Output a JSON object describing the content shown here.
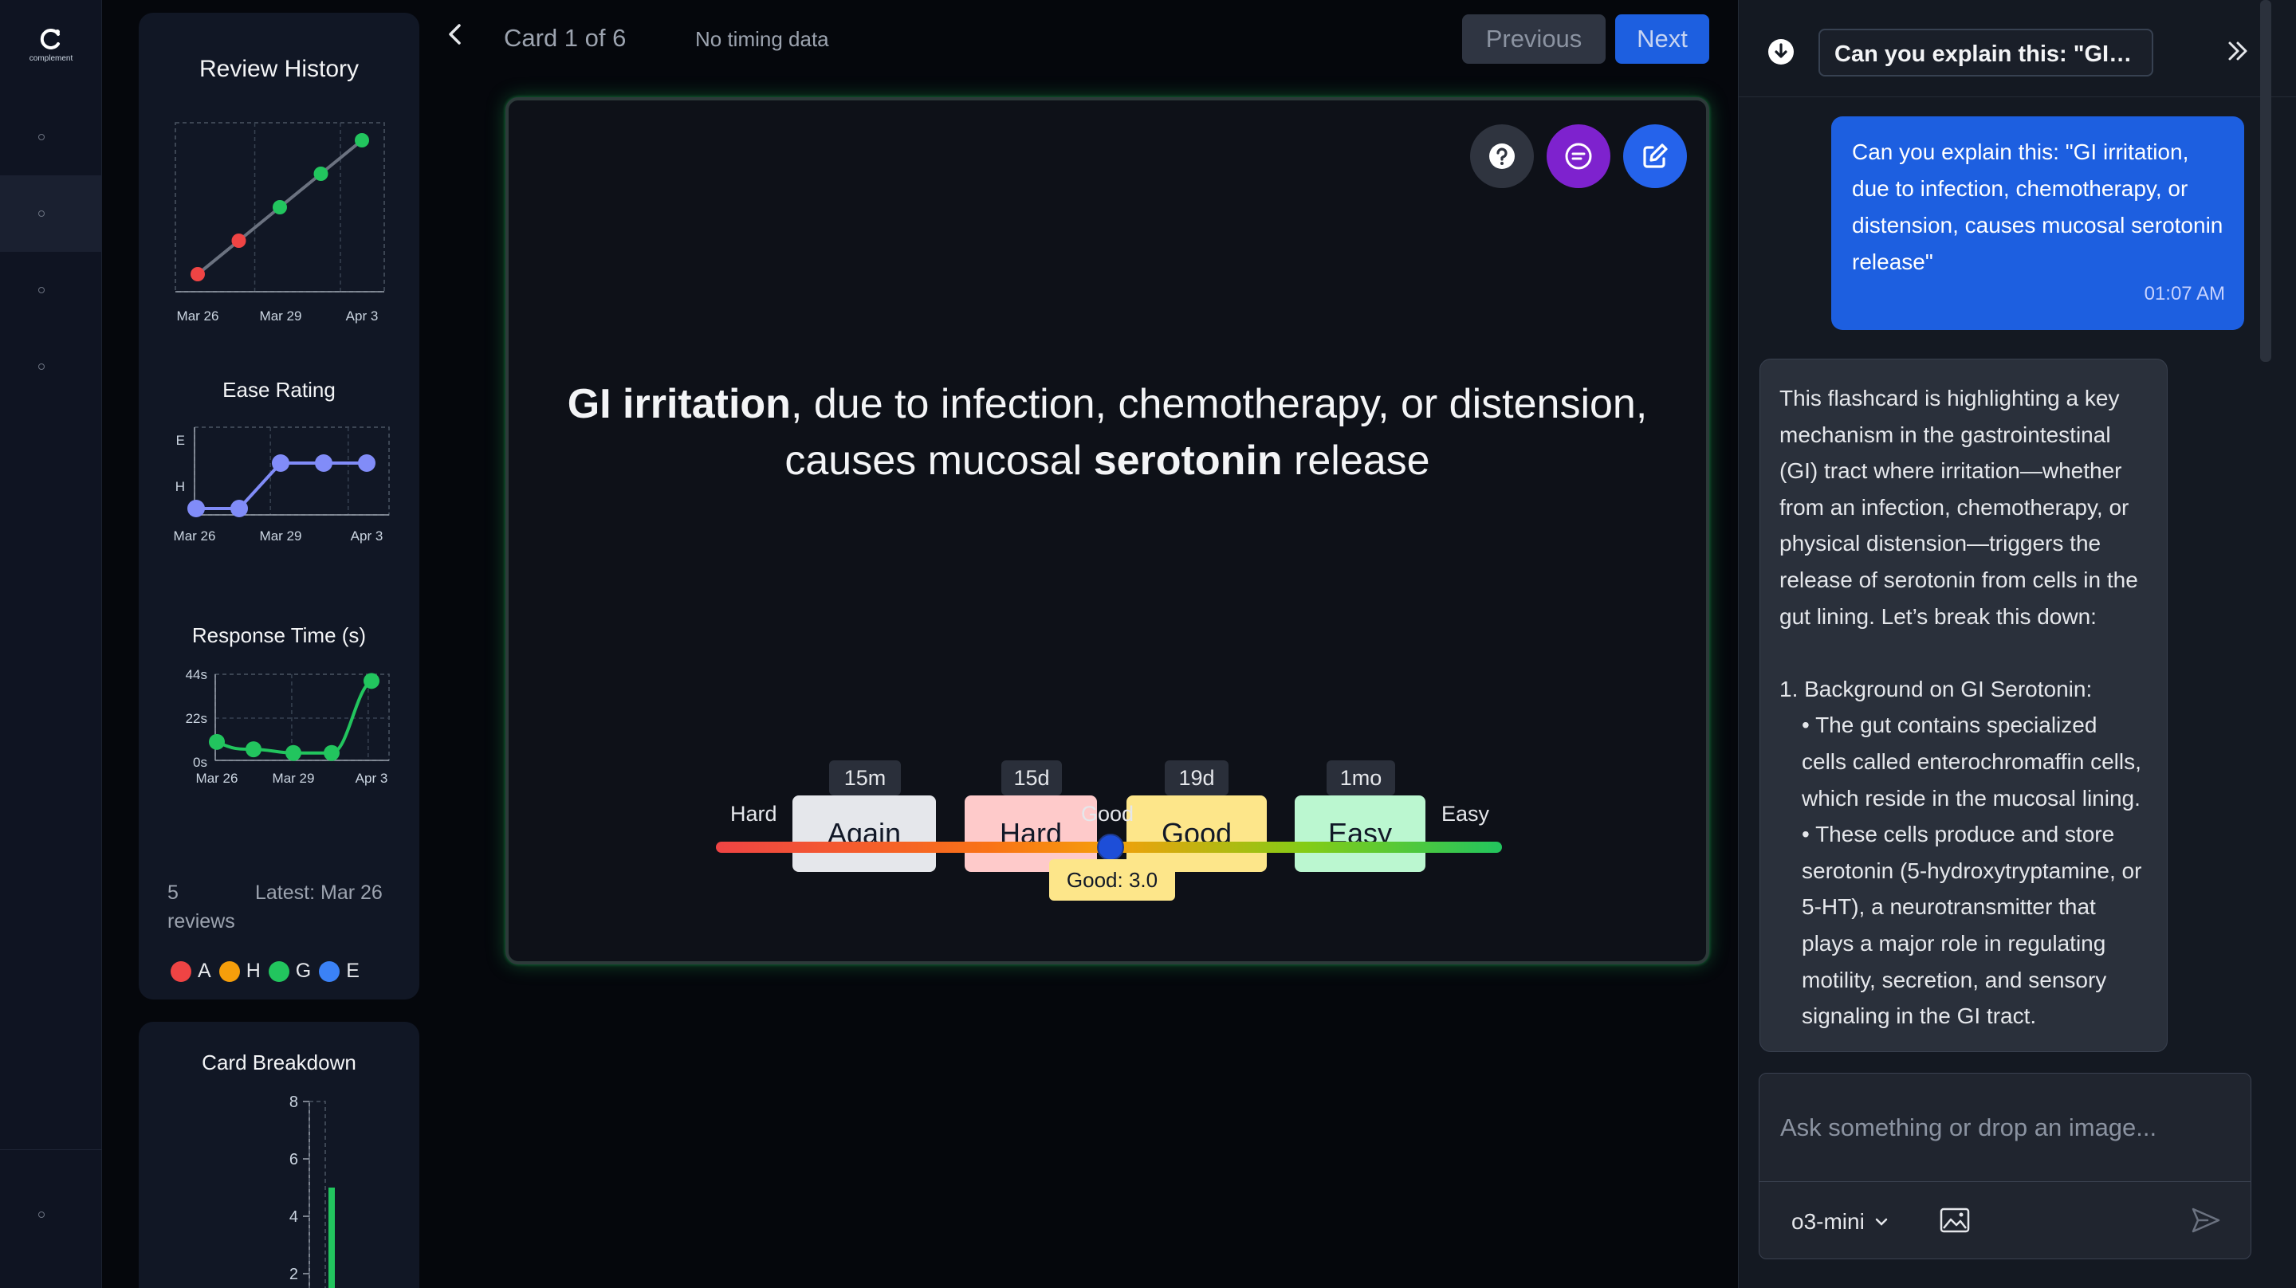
{
  "app": {
    "brand": "complement"
  },
  "stats": {
    "review_history": {
      "title": "Review History",
      "xticks": [
        "Mar 26",
        "Mar 29",
        "Apr 3"
      ]
    },
    "ease_rating": {
      "title": "Ease Rating",
      "yticks": [
        "E",
        "H"
      ],
      "xticks": [
        "Mar 26",
        "Mar 29",
        "Apr 3"
      ]
    },
    "response_time": {
      "title": "Response Time (s)",
      "yticks": [
        "44s",
        "22s",
        "0s"
      ],
      "xticks": [
        "Mar 26",
        "Mar 29",
        "Apr 3"
      ]
    },
    "reviews_count": "5 reviews",
    "latest": "Latest: Mar 26",
    "legend": [
      {
        "label": "A",
        "color": "#ef4444"
      },
      {
        "label": "H",
        "color": "#f59e0b"
      },
      {
        "label": "G",
        "color": "#22c55e"
      },
      {
        "label": "E",
        "color": "#3b82f6"
      }
    ],
    "card_breakdown": {
      "title": "Card Breakdown",
      "yticks": [
        "8",
        "6",
        "4",
        "2"
      ]
    }
  },
  "chart_data": [
    {
      "type": "line",
      "title": "Review History",
      "x": [
        "Mar 26",
        "",
        "",
        "",
        "Apr 3"
      ],
      "xticks": [
        "Mar 26",
        "Mar 29",
        "Apr 3"
      ],
      "series": [
        {
          "values": [
            1,
            2,
            3,
            4,
            5
          ],
          "point_colors": [
            "#ef4444",
            "#ef4444",
            "#22c55e",
            "#22c55e",
            "#22c55e"
          ]
        }
      ]
    },
    {
      "type": "line",
      "title": "Ease Rating",
      "yticks": [
        "E",
        "H"
      ],
      "xticks": [
        "Mar 26",
        "Mar 29",
        "Apr 3"
      ],
      "series": [
        {
          "values": [
            1,
            1,
            2,
            2,
            2
          ],
          "point_colors": [
            "#818cf8",
            "#818cf8",
            "#818cf8",
            "#818cf8",
            "#818cf8"
          ]
        }
      ]
    },
    {
      "type": "line",
      "title": "Response Time (s)",
      "yticks": [
        "44s",
        "22s",
        "0s"
      ],
      "ylim": [
        0,
        44
      ],
      "xticks": [
        "Mar 26",
        "Mar 29",
        "Apr 3"
      ],
      "series": [
        {
          "values": [
            10,
            6,
            4,
            4,
            43
          ],
          "point_colors": [
            "#22c55e",
            "#22c55e",
            "#22c55e",
            "#22c55e",
            "#22c55e"
          ]
        }
      ]
    },
    {
      "type": "bar",
      "title": "Card Breakdown",
      "yticks": [
        "8",
        "6",
        "4",
        "2"
      ],
      "ylim": [
        0,
        8
      ],
      "series": [
        {
          "values": [
            5
          ]
        }
      ]
    }
  ],
  "header": {
    "card_counter": "Card 1 of 6",
    "timing": "No timing data",
    "previous_label": "Previous",
    "next_label": "Next"
  },
  "card": {
    "front_bold_1": "GI irritation",
    "front_text_1": ", due to infection, chemotherapy, or distension, causes mucosal ",
    "front_bold_2": "serotonin",
    "front_text_2": " release",
    "answers": [
      {
        "label": "Again",
        "interval": "15m",
        "color": "#e5e7eb"
      },
      {
        "label": "Hard",
        "interval": "15d",
        "color": "#fecaca"
      },
      {
        "label": "Good",
        "interval": "19d",
        "color": "#fde68a"
      },
      {
        "label": "Easy",
        "interval": "1mo",
        "color": "#bbf7d0"
      }
    ],
    "slider": {
      "left_label": "Hard",
      "mid_label": "Good",
      "right_label": "Easy",
      "value_label": "Good: 3.0",
      "value": 0.5
    }
  },
  "chat": {
    "title": "Can you explain this: \"GI irri...",
    "user_message": "Can you explain this: \"GI irritation, due to infection, chemotherapy, or distension, causes mucosal serotonin release\"",
    "user_time": "01:07 AM",
    "bot_intro": "This flashcard is highlighting a key mechanism in the gastrointestinal (GI) tract where irritation—whether from an infection, chemotherapy, or physical distension—triggers the release of serotonin from cells in the gut lining. Let’s break this down:",
    "bot_heading": "1. Background on GI Serotonin:",
    "bot_bullet_1": "• The gut contains specialized cells called enterochromaffin cells, which reside in the mucosal lining.",
    "bot_bullet_2": "• These cells produce and store serotonin (5-hydroxytryptamine, or 5-HT), a neurotransmitter that plays a major role in regulating motility, secretion, and sensory signaling in the GI tract.",
    "input_placeholder": "Ask something or drop an image...",
    "model": "o3-mini"
  }
}
